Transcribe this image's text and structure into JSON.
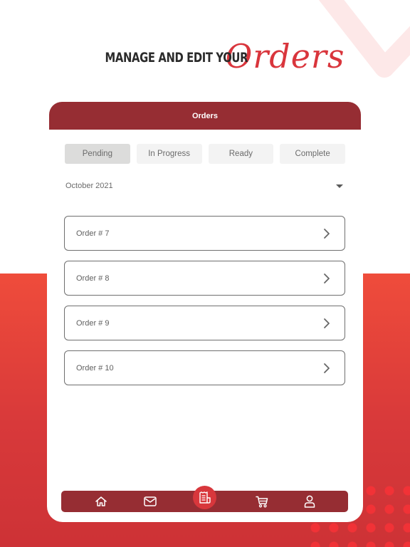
{
  "headline": {
    "prefix": "MANAGE AND EDIT YOUR",
    "script_word": "Orders"
  },
  "card": {
    "title": "Orders",
    "tabs": [
      {
        "label": "Pending",
        "active": true
      },
      {
        "label": "In Progress",
        "active": false
      },
      {
        "label": "Ready",
        "active": false
      },
      {
        "label": "Complete",
        "active": false
      }
    ],
    "month_selector": {
      "value": "October 2021",
      "icon": "caret-down-icon"
    },
    "orders": [
      {
        "label": "Order # 7",
        "icon": "chevron-right-icon"
      },
      {
        "label": "Order # 8",
        "icon": "chevron-right-icon"
      },
      {
        "label": "Order # 9",
        "icon": "chevron-right-icon"
      },
      {
        "label": "Order # 10",
        "icon": "chevron-right-icon"
      }
    ]
  },
  "bottom_nav": {
    "items": [
      {
        "name": "home",
        "icon": "home-icon"
      },
      {
        "name": "messages",
        "icon": "mail-icon"
      },
      {
        "name": "orders",
        "icon": "receipt-icon",
        "active": true
      },
      {
        "name": "cart",
        "icon": "cart-icon"
      },
      {
        "name": "profile",
        "icon": "user-icon"
      }
    ]
  },
  "colors": {
    "brand_dark_red": "#962d33",
    "accent_red": "#d9353c",
    "background_red": "#ef4c3b",
    "tab_active": "#dcdcdb",
    "tab_inactive": "#f3f3f3"
  }
}
